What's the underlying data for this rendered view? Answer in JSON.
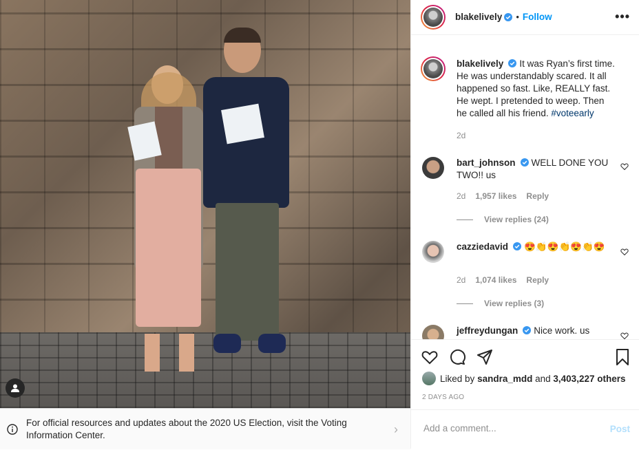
{
  "post": {
    "username": "blakelively",
    "follow_label": "Follow",
    "more_label": "•••",
    "caption": "It was Ryan’s first time. He was understandably scared. It all happened so fast. Like, REALLY fast. He wept. I pretended to weep. Then he called all his friend.",
    "hashtag": "#voteearly",
    "caption_age": "2d"
  },
  "comments": [
    {
      "username": "bart_johnson",
      "text": "WELL DONE YOU TWO!! us",
      "age": "2d",
      "likes": "1,957 likes",
      "reply_label": "Reply",
      "view_replies": "View replies (24)"
    },
    {
      "username": "cazziedavid",
      "text": "😍👏😍👏😍👏😍",
      "age": "2d",
      "likes": "1,074 likes",
      "reply_label": "Reply",
      "view_replies": "View replies (3)"
    },
    {
      "username": "jeffreydungan",
      "text": "Nice work. us"
    }
  ],
  "engagement": {
    "liked_by_prefix": "Liked by",
    "liked_by_user": "sandra_mdd",
    "liked_by_and": "and",
    "others_count": "3,403,227 others",
    "date_label": "2 DAYS AGO"
  },
  "comment_box": {
    "placeholder": "Add a comment...",
    "post_label": "Post"
  },
  "election_banner": {
    "text": "For official resources and updates about the 2020 US Election, visit the Voting Information Center."
  },
  "icons": {
    "heart": "heart-icon",
    "comment": "comment-icon",
    "share": "share-icon",
    "save": "bookmark-icon",
    "verified": "verified-badge-icon",
    "tag": "user-tag-icon",
    "info": "info-icon",
    "chevron": "chevron-right-icon"
  },
  "colors": {
    "link": "#0095f6",
    "verified": "#3897f0",
    "hashtag": "#00376b",
    "muted": "#8e8e8e"
  }
}
